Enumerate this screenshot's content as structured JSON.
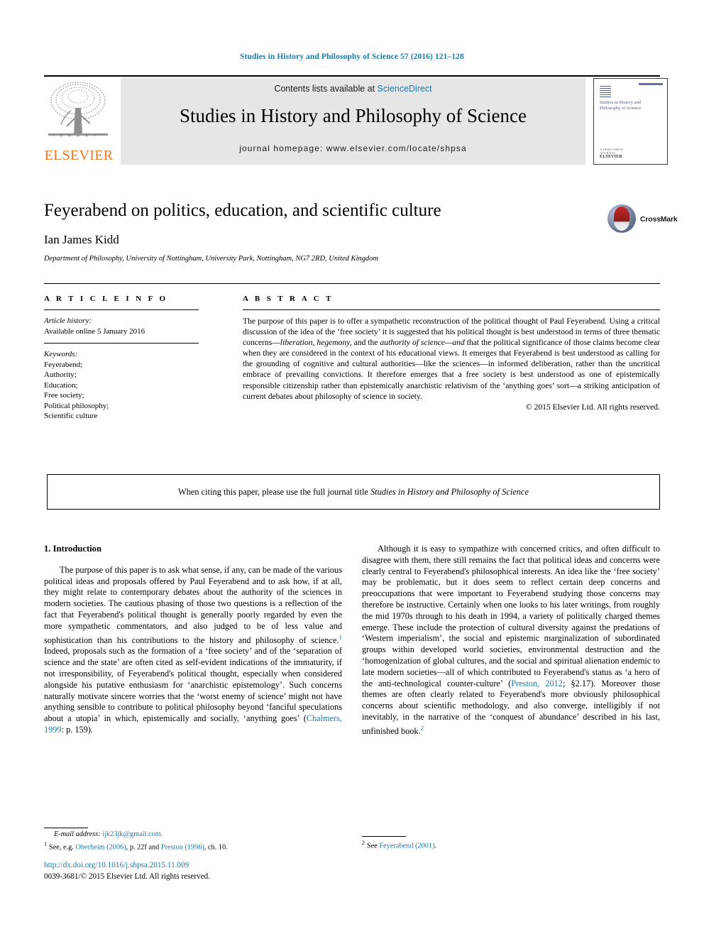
{
  "running_head": "Studies in History and Philosophy of Science 57 (2016) 121–128",
  "masthead": {
    "publisher_name": "ELSEVIER",
    "contents_prefix": "Contents lists available at ",
    "contents_link": "ScienceDirect",
    "journal_title": "Studies in History and Philosophy of Science",
    "homepage_label": "journal homepage: www.elsevier.com/locate/shpsa",
    "cover_title": "Studies in History and Philosophy of Science",
    "cover_footer_top": "A PERGAMON JOURNAL",
    "cover_footer_bottom": "ELSEVIER"
  },
  "article": {
    "title": "Feyerabend on politics, education, and scientific culture",
    "authors": "Ian James Kidd",
    "affiliation": "Department of Philosophy, University of Nottingham, University Park, Nottingham, NG7 2RD, United Kingdom",
    "crossmark_label": "CrossMark"
  },
  "article_info": {
    "heading": "A R T I C L E   I N F O",
    "history_label": "Article history:",
    "history_value": "Available online 5 January 2016",
    "keywords_label": "Keywords:",
    "keywords": [
      "Feyerabend;",
      "Authority;",
      "Education;",
      "Free society;",
      "Political philosophy;",
      "Scientific culture"
    ]
  },
  "abstract": {
    "heading": "A B S T R A C T",
    "part1": "The purpose of this paper is to offer a sympathetic reconstruction of the political thought of Paul Feyerabend. Using a critical discussion of the idea of the ‘free society’ it is suggested that his political thought is best understood in terms of three thematic concerns—",
    "italic1": "liberation, hegemony,",
    "mid1": " and the ",
    "italic2": "authority of science—and",
    "part2": " that the political significance of those claims become clear when they are considered in the context of his educational views. It emerges that Feyerabend is best understood as calling for the grounding of cognitive and cultural authorities—like the sciences—in informed deliberation, rather than the uncritical embrace of prevailing convictions. It therefore emerges that a free society is best understood as one of epistemically responsible citizenship rather than epistemically anarchistic relativism of the ‘anything goes’ sort—a striking anticipation of current debates about philosophy of science in society.",
    "copyright": "© 2015 Elsevier Ltd. All rights reserved."
  },
  "citation_notice": {
    "prefix": "When citing this paper, please use the full journal title ",
    "journal": "Studies in History and Philosophy of Science"
  },
  "body": {
    "section_heading": "1. Introduction",
    "left_p1_a": "The purpose of this paper is to ask what sense, if any, can be made of the various political ideas and proposals offered by Paul Feyerabend and to ask how, if at all, they might relate to contemporary debates about the authority of the sciences in modern societies. The cautious phasing of those two questions is a reflection of the fact that Feyerabend's political thought is generally poorly regarded by even the more sympathetic commentators, and also judged to be of less value and sophistication than his contributions to the history and philosophy of science.",
    "left_fn_marker_1": "1",
    "left_p1_b": " Indeed, proposals such as the formation of a ‘free society’ and of the ‘separation of science and the state’ are often cited as self-evident indications of the immaturity, if not irresponsibility, of Feyerabend's political thought, especially when considered alongside his putative enthusiasm for ‘anarchistic epistemology’. Such concerns naturally motivate sincere worries that the ‘worst enemy of science’ might not have anything sensible to contribute to political philosophy beyond ‘fanciful speculations about a utopia’ in which, epistemically and socially, ‘anything goes’ (",
    "left_ref_1": "Chalmers, 1999",
    "left_p1_c": ": p. 159).",
    "right_p1_a": "Although it is easy to sympathize with concerned critics, and often difficult to disagree with them, there still remains the fact that political ideas and concerns were clearly central to Feyerabend's philosophical interests. An idea like the ‘free society’ may be problematic, but it does seem to reflect certain deep concerns and preoccupations that were important to Feyerabend studying those concerns may therefore be instructive. Certainly when one looks to his later writings, from roughly the mid 1970s through to his death in 1994, a variety of politically charged themes emerge. These include the protection of cultural diversity against the predations of ‘Western imperialism’, the social and epistemic marginalization of subordinated groups within developed world societies, environmental destruction and the ‘homogenization of global cultures, and the social and spiritual alienation endemic to late modern societies—all of which contributed to Feyerabend's status as ‘a hero of the anti-technological counter-culture’ (",
    "right_ref_1": "Preston, 2012",
    "right_p1_b": "; §2.17). Moreover those themes are often clearly related to Feyerabend's more obviously philosophical concerns about scientific methodology, and also converge, intelligibly if not inevitably, in the narrative of the ‘conquest of abundance’ described in his last, unfinished book.",
    "right_fn_marker_2": "2"
  },
  "footnotes": {
    "email_label": "E-mail address:",
    "email_value": "ijk23jk@gmail.com.",
    "note1_marker": "1",
    "note1_a": "See, e.g. ",
    "note1_ref1": "Oberheim (2006)",
    "note1_b": ", p. 22f and ",
    "note1_ref2": "Preston (1996)",
    "note1_c": ", ch. 10.",
    "note2_marker": "2",
    "note2_a": "See ",
    "note2_ref": "Feyerabend (2001)",
    "note2_b": "."
  },
  "imprint": {
    "doi": "http://dx.doi.org/10.1016/j.shpsa.2015.11.009",
    "issn": "0039-3681/© 2015 Elsevier Ltd. All rights reserved."
  },
  "colors": {
    "link_blue": "#1a7aa8",
    "elsevier_orange": "#e87722",
    "band_gray": "#e6e6e6",
    "cover_blue": "#4a5c96"
  }
}
